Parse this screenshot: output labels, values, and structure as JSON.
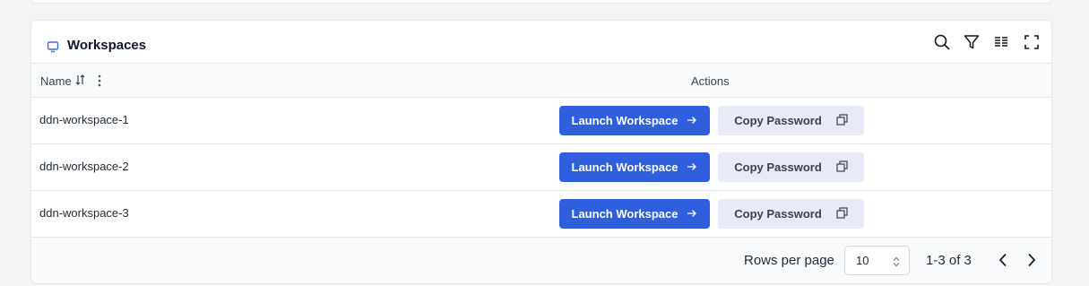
{
  "panel": {
    "title": "Workspaces",
    "icon": "monitor-icon",
    "toolbar": [
      "search-icon",
      "filter-icon",
      "columns-icon",
      "fullscreen-icon"
    ]
  },
  "table": {
    "columns": {
      "name": "Name",
      "actions": "Actions"
    },
    "rows": [
      {
        "name": "ddn-workspace-1",
        "launch_label": "Launch Workspace",
        "copy_label": "Copy Password"
      },
      {
        "name": "ddn-workspace-2",
        "launch_label": "Launch Workspace",
        "copy_label": "Copy Password"
      },
      {
        "name": "ddn-workspace-3",
        "launch_label": "Launch Workspace",
        "copy_label": "Copy Password"
      }
    ]
  },
  "pagination": {
    "rows_per_page_label": "Rows per page",
    "rows_per_page_value": "10",
    "range": "1-3 of 3"
  },
  "colors": {
    "accent": "#2f5fdc",
    "secondary_button": "#e8ebf7"
  }
}
